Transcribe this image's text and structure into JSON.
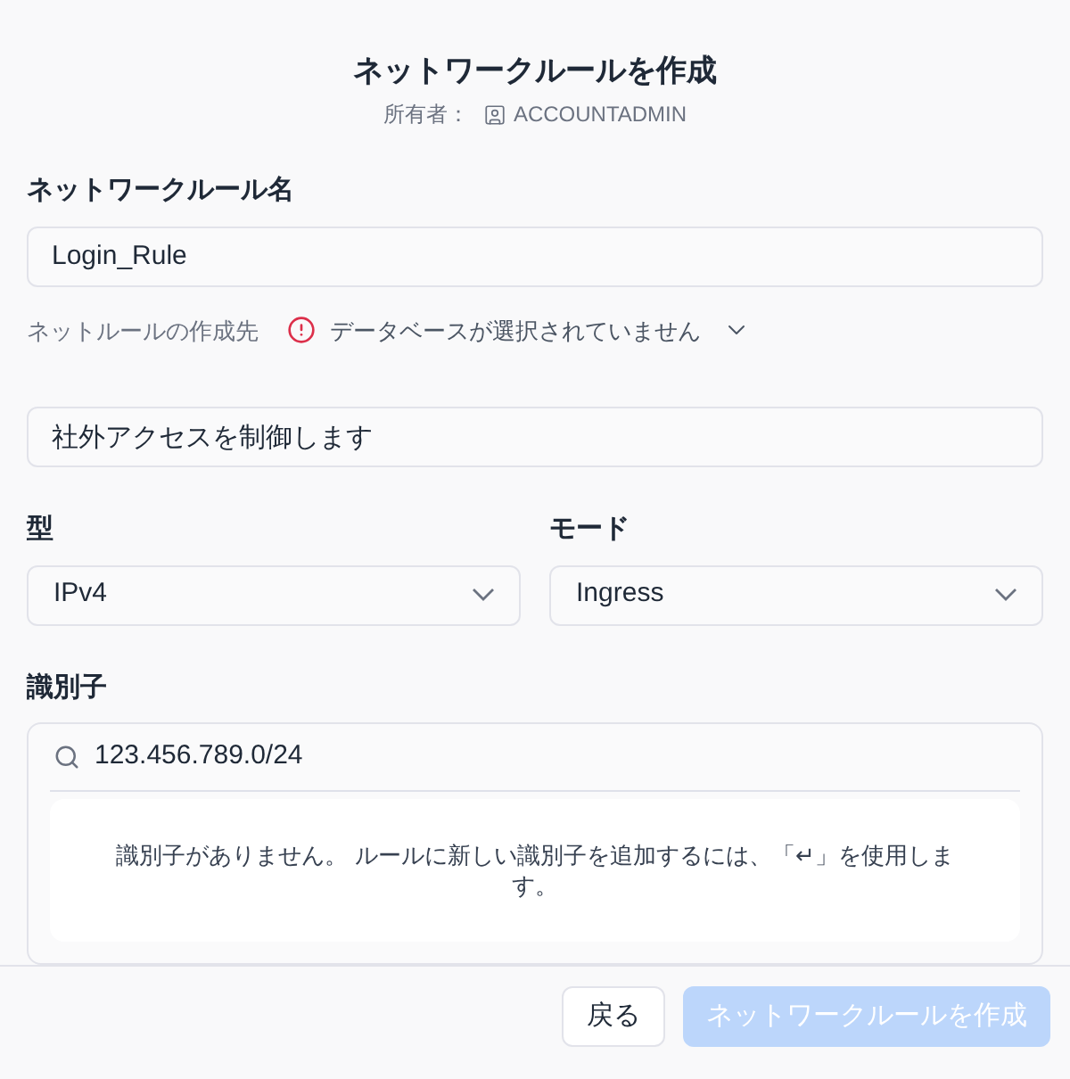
{
  "dialog": {
    "title": "ネットワークルールを作成",
    "owner_label": "所有者：",
    "owner": "ACCOUNTADMIN"
  },
  "name_field": {
    "label": "ネットワークルール名",
    "value": "Login_Rule"
  },
  "location": {
    "label": "ネットルールの作成先",
    "value": "データベースが選択されていません"
  },
  "description_field": {
    "value": "社外アクセスを制御します"
  },
  "type_select": {
    "label": "型",
    "value": "IPv4"
  },
  "mode_select": {
    "label": "モード",
    "value": "Ingress"
  },
  "identifiers": {
    "label": "識別子",
    "search_value": "123.456.789.0/24",
    "empty_message": "識別子がありません。 ルールに新しい識別子を追加するには、「↵」を使用します。"
  },
  "buttons": [
    {
      "label": "戻る",
      "kind": "secondary",
      "disabled": false
    },
    {
      "label": "ネットワークルールを作成",
      "kind": "primary",
      "disabled": true
    }
  ]
}
